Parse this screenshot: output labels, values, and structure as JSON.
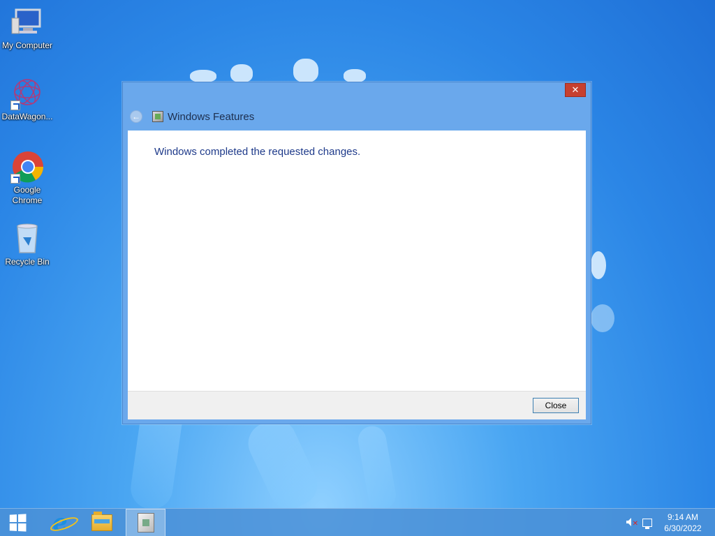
{
  "desktop": {
    "icons": [
      {
        "label": "My Computer",
        "icon": "computer-icon"
      },
      {
        "label": "DataWagon...",
        "icon": "datawagon-icon"
      },
      {
        "label": "Google Chrome",
        "icon": "chrome-icon"
      },
      {
        "label": "Recycle Bin",
        "icon": "recycle-bin-icon"
      }
    ]
  },
  "dialog": {
    "title": "Windows Features",
    "close_glyph": "✕",
    "back_glyph": "←",
    "message": "Windows completed the requested changes.",
    "close_button_label": "Close"
  },
  "taskbar": {
    "items": [
      {
        "icon": "start-icon"
      },
      {
        "icon": "internet-explorer-icon"
      },
      {
        "icon": "file-explorer-icon"
      },
      {
        "icon": "windows-features-icon",
        "active": true
      }
    ],
    "tray": {
      "volume_icon": "volume-muted-icon",
      "network_icon": "network-icon",
      "time": "9:14 AM",
      "date": "6/30/2022"
    }
  },
  "colors": {
    "desktop_bg": "#2b86e6",
    "dialog_frame": "#6aa8ec",
    "close_red": "#c7402f",
    "message_text": "#1e3a8a"
  }
}
